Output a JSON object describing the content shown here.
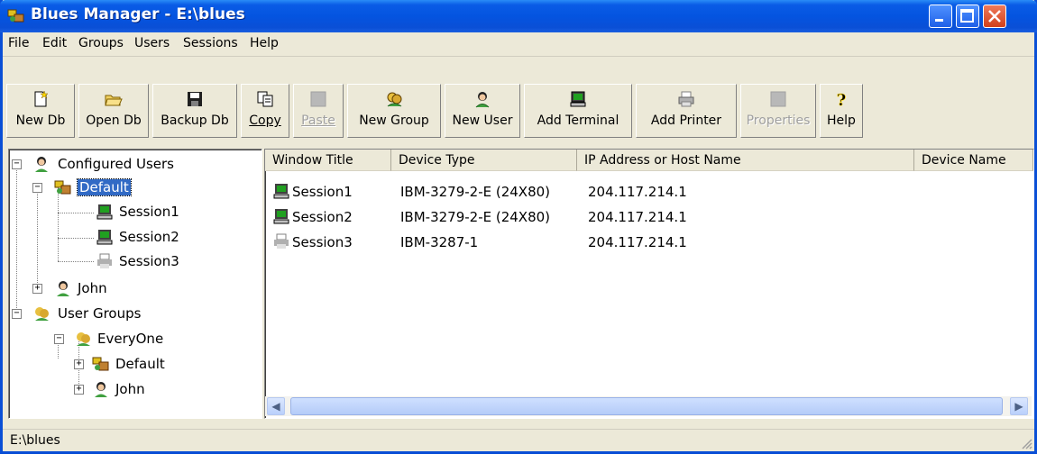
{
  "window": {
    "title": "Blues Manager - E:\\blues",
    "colors": {
      "titlebar": "#0a4fd6",
      "selection": "#316ac5",
      "face": "#ece9d8"
    }
  },
  "menu": [
    {
      "label": "File"
    },
    {
      "label": "Edit"
    },
    {
      "label": "Groups"
    },
    {
      "label": "Users"
    },
    {
      "label": "Sessions"
    },
    {
      "label": "Help"
    }
  ],
  "toolbar": [
    {
      "label": "New Db",
      "icon": "new-db-icon",
      "enabled": true
    },
    {
      "label": "Open Db",
      "icon": "open-folder-icon",
      "enabled": true
    },
    {
      "label": "Backup Db",
      "icon": "floppy-disk-icon",
      "enabled": true
    },
    {
      "label": "Copy",
      "icon": "copy-icon",
      "enabled": true
    },
    {
      "label": "Paste",
      "icon": "paste-icon",
      "enabled": false
    },
    {
      "label": "New Group",
      "icon": "group-icon",
      "enabled": true
    },
    {
      "label": "New User",
      "icon": "user-icon",
      "enabled": true
    },
    {
      "label": "Add Terminal",
      "icon": "terminal-icon",
      "enabled": true
    },
    {
      "label": "Add Printer",
      "icon": "printer-icon",
      "enabled": true
    },
    {
      "label": "Properties",
      "icon": "properties-icon",
      "enabled": false
    },
    {
      "label": "Help",
      "icon": "help-icon",
      "enabled": true
    }
  ],
  "tree": [
    {
      "label": "Configured Users",
      "icon": "user-icon",
      "expanded": true
    },
    {
      "label": "Default",
      "icon": "group-icon",
      "expanded": true,
      "selected": true
    },
    {
      "label": "Session1",
      "icon": "terminal-icon"
    },
    {
      "label": "Session2",
      "icon": "terminal-icon"
    },
    {
      "label": "Session3",
      "icon": "printer-icon"
    },
    {
      "label": "John",
      "icon": "user-icon",
      "expanded": false
    },
    {
      "label": "User Groups",
      "icon": "group-icon",
      "expanded": true
    },
    {
      "label": "EveryOne",
      "icon": "group-icon",
      "expanded": true
    },
    {
      "label": "Default",
      "icon": "group-icon",
      "expanded": false
    },
    {
      "label": "John",
      "icon": "user-icon",
      "expanded": false
    }
  ],
  "list": {
    "columns": [
      "Window Title",
      "Device Type",
      "IP Address or Host Name",
      "Device Name"
    ],
    "rows": [
      {
        "title": "Session1",
        "icon": "terminal-icon",
        "device_type": "IBM-3279-2-E (24X80)",
        "ip": "204.117.214.1",
        "device_name": ""
      },
      {
        "title": "Session2",
        "icon": "terminal-icon",
        "device_type": "IBM-3279-2-E (24X80)",
        "ip": "204.117.214.1",
        "device_name": ""
      },
      {
        "title": "Session3",
        "icon": "printer-icon",
        "device_type": "IBM-3287-1",
        "ip": "204.117.214.1",
        "device_name": ""
      }
    ]
  },
  "status": {
    "path": "E:\\blues"
  }
}
